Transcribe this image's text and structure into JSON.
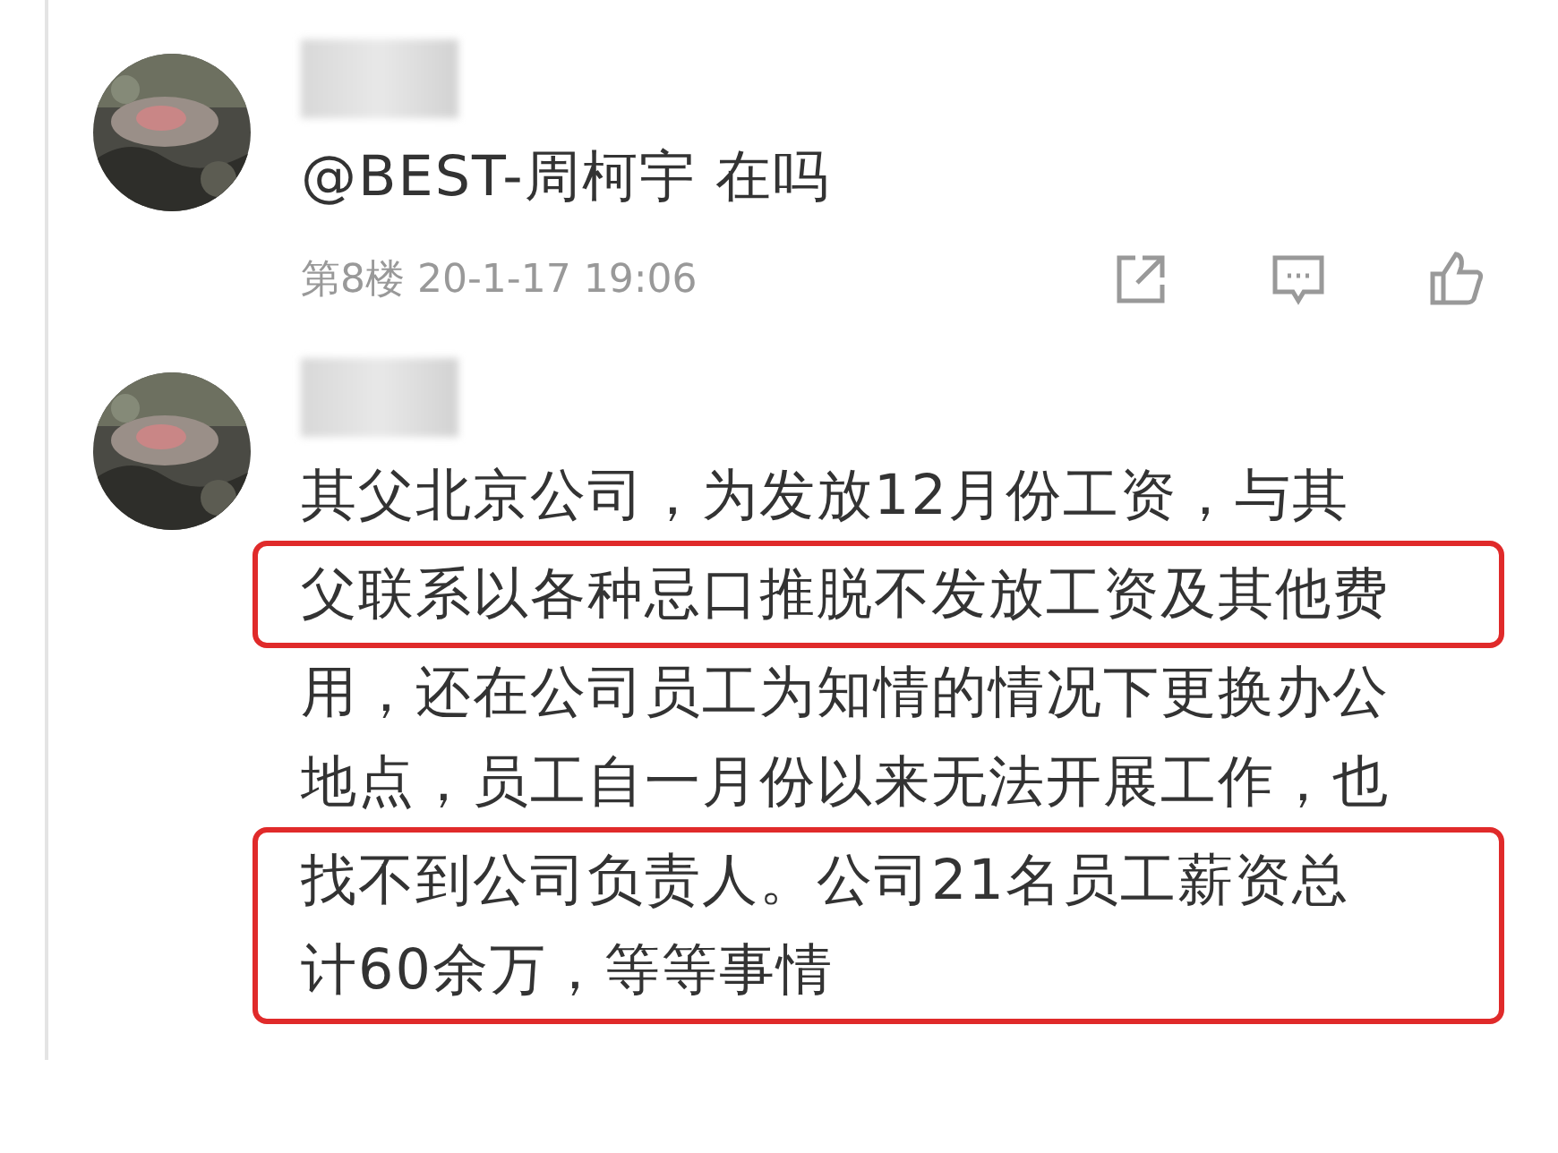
{
  "comments": [
    {
      "avatar": {
        "kind": "picture"
      },
      "blocks": [
        {
          "highlighted": false,
          "lines": [
            "@BEST-周柯宇 在吗"
          ]
        }
      ],
      "meta": "第8楼 20-1-17 19:06",
      "actions": [
        {
          "kind": "share"
        },
        {
          "kind": "comment"
        },
        {
          "kind": "like"
        }
      ]
    },
    {
      "avatar": {
        "kind": "picture"
      },
      "blocks": [
        {
          "highlighted": false,
          "lines": [
            "其父北京公司，为发放12月份工资，与其"
          ]
        },
        {
          "highlighted": true,
          "lines": [
            "父联系以各种忌口推脱不发放工资及其他费"
          ]
        },
        {
          "highlighted": false,
          "lines": [
            "用，还在公司员工为知情的情况下更换办公",
            "地点，员工自一月份以来无法开展工作，也"
          ]
        },
        {
          "highlighted": true,
          "lines": [
            "找不到公司负责人。公司21名员工薪资总",
            "计60余万，等等事情"
          ]
        }
      ]
    }
  ]
}
